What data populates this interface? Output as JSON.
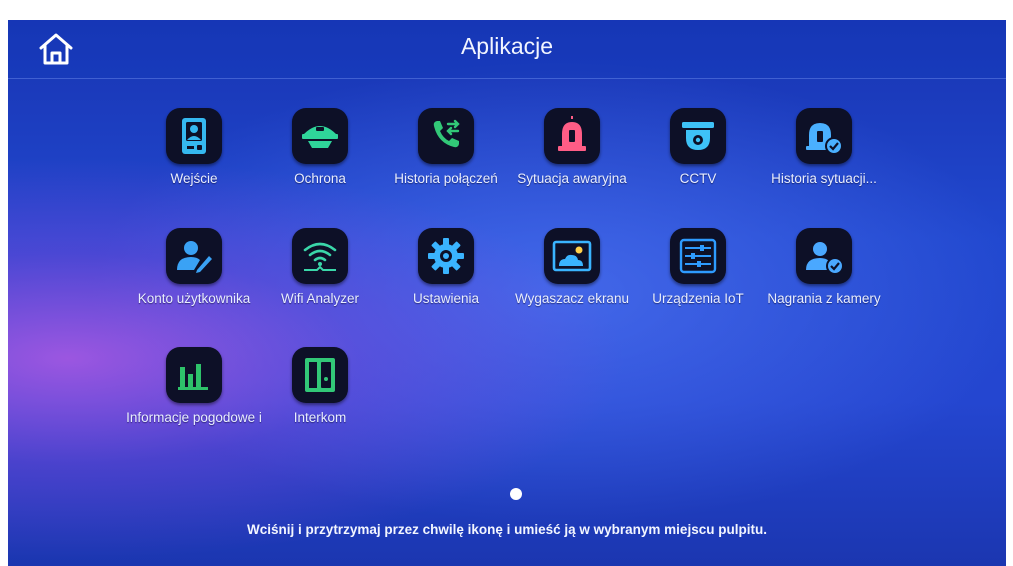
{
  "header": {
    "title": "Aplikacje",
    "home_icon": "home-icon"
  },
  "apps": [
    {
      "label": "Wejście",
      "icon": "door-station-icon",
      "color": "#35b8f0"
    },
    {
      "label": "Ochrona",
      "icon": "security-shield-icon",
      "color": "#2fd59a"
    },
    {
      "label": "Historia połączeń",
      "icon": "call-history-icon",
      "color": "#32c878"
    },
    {
      "label": "Sytuacja awaryjna",
      "icon": "emergency-siren-icon",
      "color": "#ff5d86"
    },
    {
      "label": "CCTV",
      "icon": "cctv-camera-icon",
      "color": "#3ec2f7"
    },
    {
      "label": "Historia sytuacji...",
      "icon": "alarm-history-icon",
      "color": "#4ab0ff"
    },
    {
      "label": "Konto użytkownika",
      "icon": "user-account-icon",
      "color": "#3aa2f5"
    },
    {
      "label": "Wifi Analyzer",
      "icon": "wifi-icon",
      "color": "#3ad7a9"
    },
    {
      "label": "Ustawienia",
      "icon": "settings-gear-icon",
      "color": "#3ab4ff"
    },
    {
      "label": "Wygaszacz ekranu",
      "icon": "screensaver-icon",
      "color": "#3ab4ff"
    },
    {
      "label": "Urządzenia IoT",
      "icon": "iot-sliders-icon",
      "color": "#2e9bff"
    },
    {
      "label": "Nagrania z kamery",
      "icon": "camera-recordings-icon",
      "color": "#4aa8ff"
    },
    {
      "label": "Informacje pogodowe i",
      "icon": "weather-chart-icon",
      "color": "#2ec26a"
    },
    {
      "label": "Interkom",
      "icon": "intercom-icon",
      "color": "#32c878"
    }
  ],
  "pager": {
    "pages": 1,
    "current": 1
  },
  "hint": "Wciśnij i przytrzymaj przez chwilę ikonę i umieść ją w wybranym miejscu pulpitu."
}
